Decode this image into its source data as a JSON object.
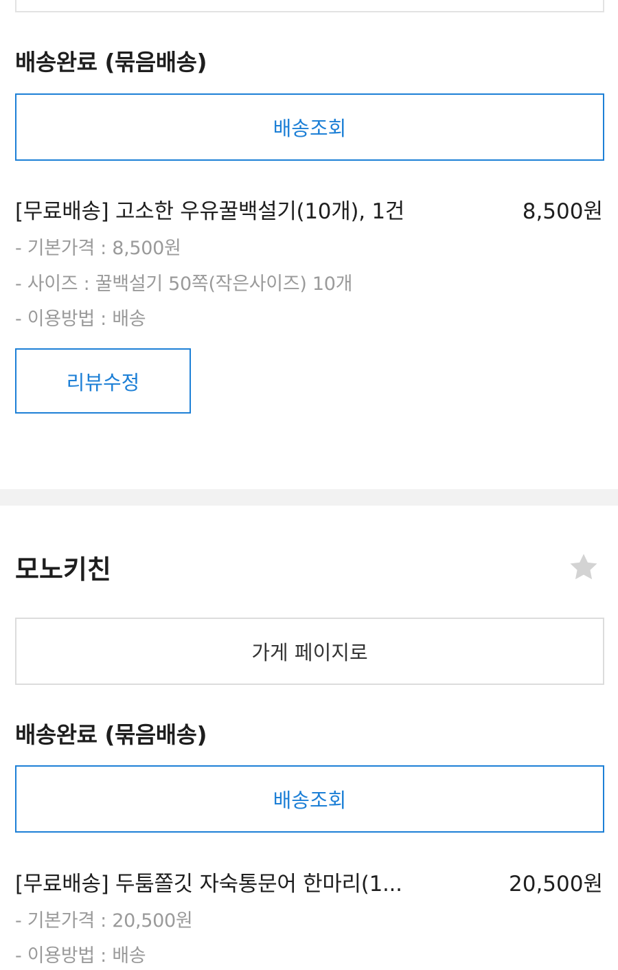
{
  "order1": {
    "status": "배송완료 (묶음배송)",
    "track_label": "배송조회",
    "item": {
      "title": "[무료배송] 고소한 우유꿀백설기(10개), 1건",
      "price": "8,500원",
      "options": [
        "- 기본가격 : 8,500원",
        "- 사이즈 : 꿀백설기 50쪽(작은사이즈) 10개",
        "- 이용방법 : 배송"
      ]
    },
    "review_label": "리뷰수정"
  },
  "store2": {
    "name": "모노키친",
    "favorite_icon": "star-icon",
    "store_page_label": "가게 페이지로"
  },
  "order2": {
    "status": "배송완료 (묶음배송)",
    "track_label": "배송조회",
    "item": {
      "title": "[무료배송] 두툼쫄깃 자숙통문어 한마리(1...",
      "price": "20,500원",
      "options": [
        "- 기본가격 : 20,500원",
        "- 이용방법 : 배송"
      ]
    }
  },
  "colors": {
    "accent": "#1c7fd6",
    "separator": "#f2f2f2",
    "muted_text": "#9a9a9a",
    "star": "#d3d3d3"
  }
}
